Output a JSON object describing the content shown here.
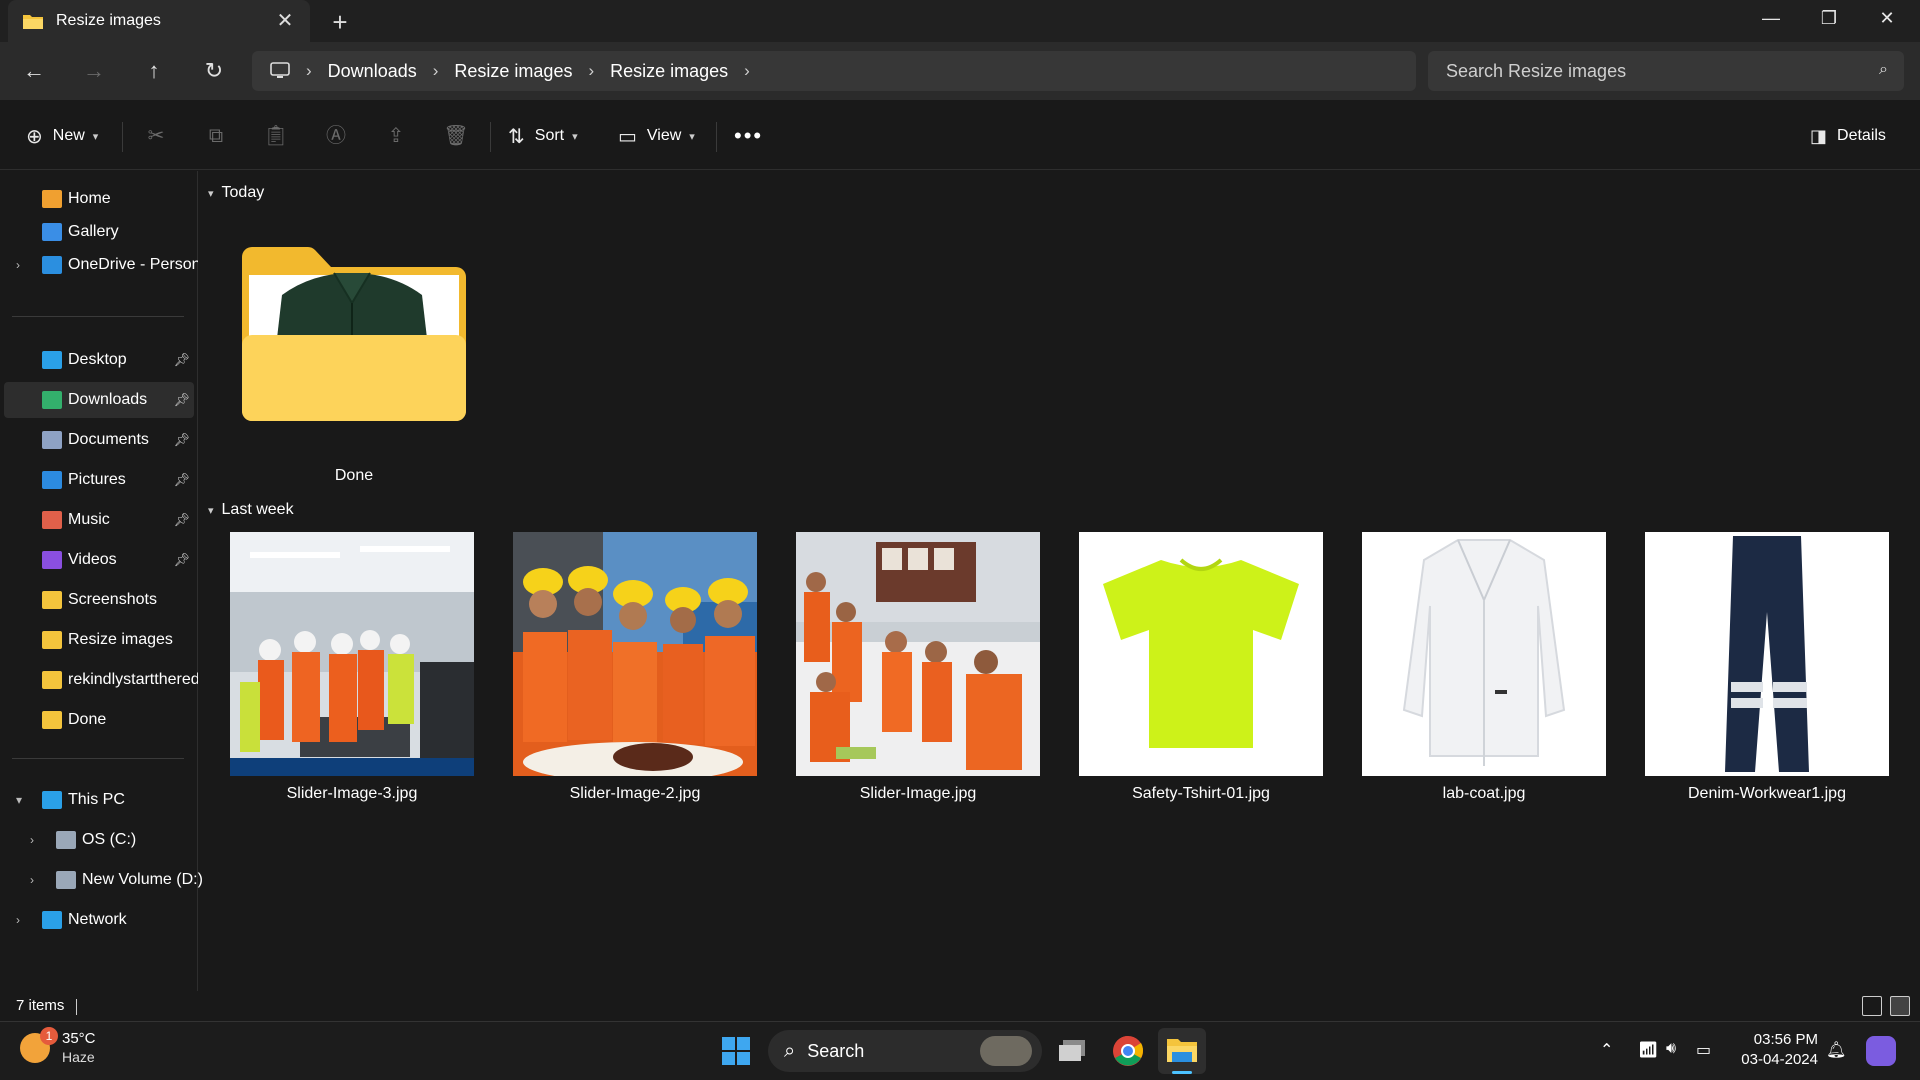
{
  "window": {
    "tab_title": "Resize images",
    "tab_icon": "folder-icon"
  },
  "breadcrumb": {
    "items": [
      "Downloads",
      "Resize images",
      "Resize images"
    ]
  },
  "search": {
    "placeholder": "Search Resize images"
  },
  "commandbar": {
    "new_label": "New",
    "sort_label": "Sort",
    "view_label": "View",
    "details_label": "Details"
  },
  "sidebar": {
    "quick": [
      {
        "label": "Home",
        "icon": "home-icon",
        "color": "#f0a030"
      },
      {
        "label": "Gallery",
        "icon": "gallery-icon",
        "color": "#3a8ee6"
      },
      {
        "label": "OneDrive - Persona",
        "icon": "cloud-icon",
        "color": "#2b8fe0"
      }
    ],
    "pinned": [
      {
        "label": "Desktop",
        "icon": "desktop-icon",
        "color": "#2aa0e8",
        "pinned": true
      },
      {
        "label": "Downloads",
        "icon": "download-icon",
        "color": "#33b06c",
        "pinned": true,
        "selected": true
      },
      {
        "label": "Documents",
        "icon": "documents-icon",
        "color": "#8ea2c4",
        "pinned": true
      },
      {
        "label": "Pictures",
        "icon": "pictures-icon",
        "color": "#2c8be0",
        "pinned": true
      },
      {
        "label": "Music",
        "icon": "music-icon",
        "color": "#e0604a",
        "pinned": true
      },
      {
        "label": "Videos",
        "icon": "videos-icon",
        "color": "#8a4fe0",
        "pinned": true
      },
      {
        "label": "Screenshots",
        "icon": "folder-icon",
        "color": "#f4c43c",
        "pinned": false
      },
      {
        "label": "Resize images",
        "icon": "folder-icon",
        "color": "#f4c43c",
        "pinned": false
      },
      {
        "label": "rekindlystarttheredet",
        "icon": "folder-icon",
        "color": "#f4c43c",
        "pinned": false
      },
      {
        "label": "Done",
        "icon": "folder-icon",
        "color": "#f4c43c",
        "pinned": false
      }
    ],
    "devices": [
      {
        "label": "This PC",
        "icon": "pc-icon",
        "color": "#2aa0e8",
        "expanded": true
      },
      {
        "label": "OS (C:)",
        "icon": "drive-icon",
        "color": "#9aa8b8"
      },
      {
        "label": "New Volume (D:)",
        "icon": "drive-icon",
        "color": "#9aa8b8"
      },
      {
        "label": "Network",
        "icon": "network-icon",
        "color": "#2aa0e8"
      }
    ]
  },
  "content": {
    "groups": [
      {
        "title": "Today"
      },
      {
        "title": "Last week"
      }
    ],
    "folder": {
      "name": "Done"
    },
    "files": [
      {
        "name": "Slider-Image-3.jpg"
      },
      {
        "name": "Slider-Image-2.jpg"
      },
      {
        "name": "Slider-Image.jpg"
      },
      {
        "name": "Safety-Tshirt-01.jpg"
      },
      {
        "name": "lab-coat.jpg"
      },
      {
        "name": "Denim-Workwear1.jpg"
      }
    ]
  },
  "status": {
    "item_count": "7 items"
  },
  "taskbar": {
    "weather_temp": "35°C",
    "weather_cond": "Haze",
    "weather_badge": "1",
    "search_label": "Search",
    "time": "03:56 PM",
    "date": "03-04-2024"
  },
  "colors": {
    "accent": "#4cc2ff",
    "folder_yellow": "#f4c43c"
  }
}
